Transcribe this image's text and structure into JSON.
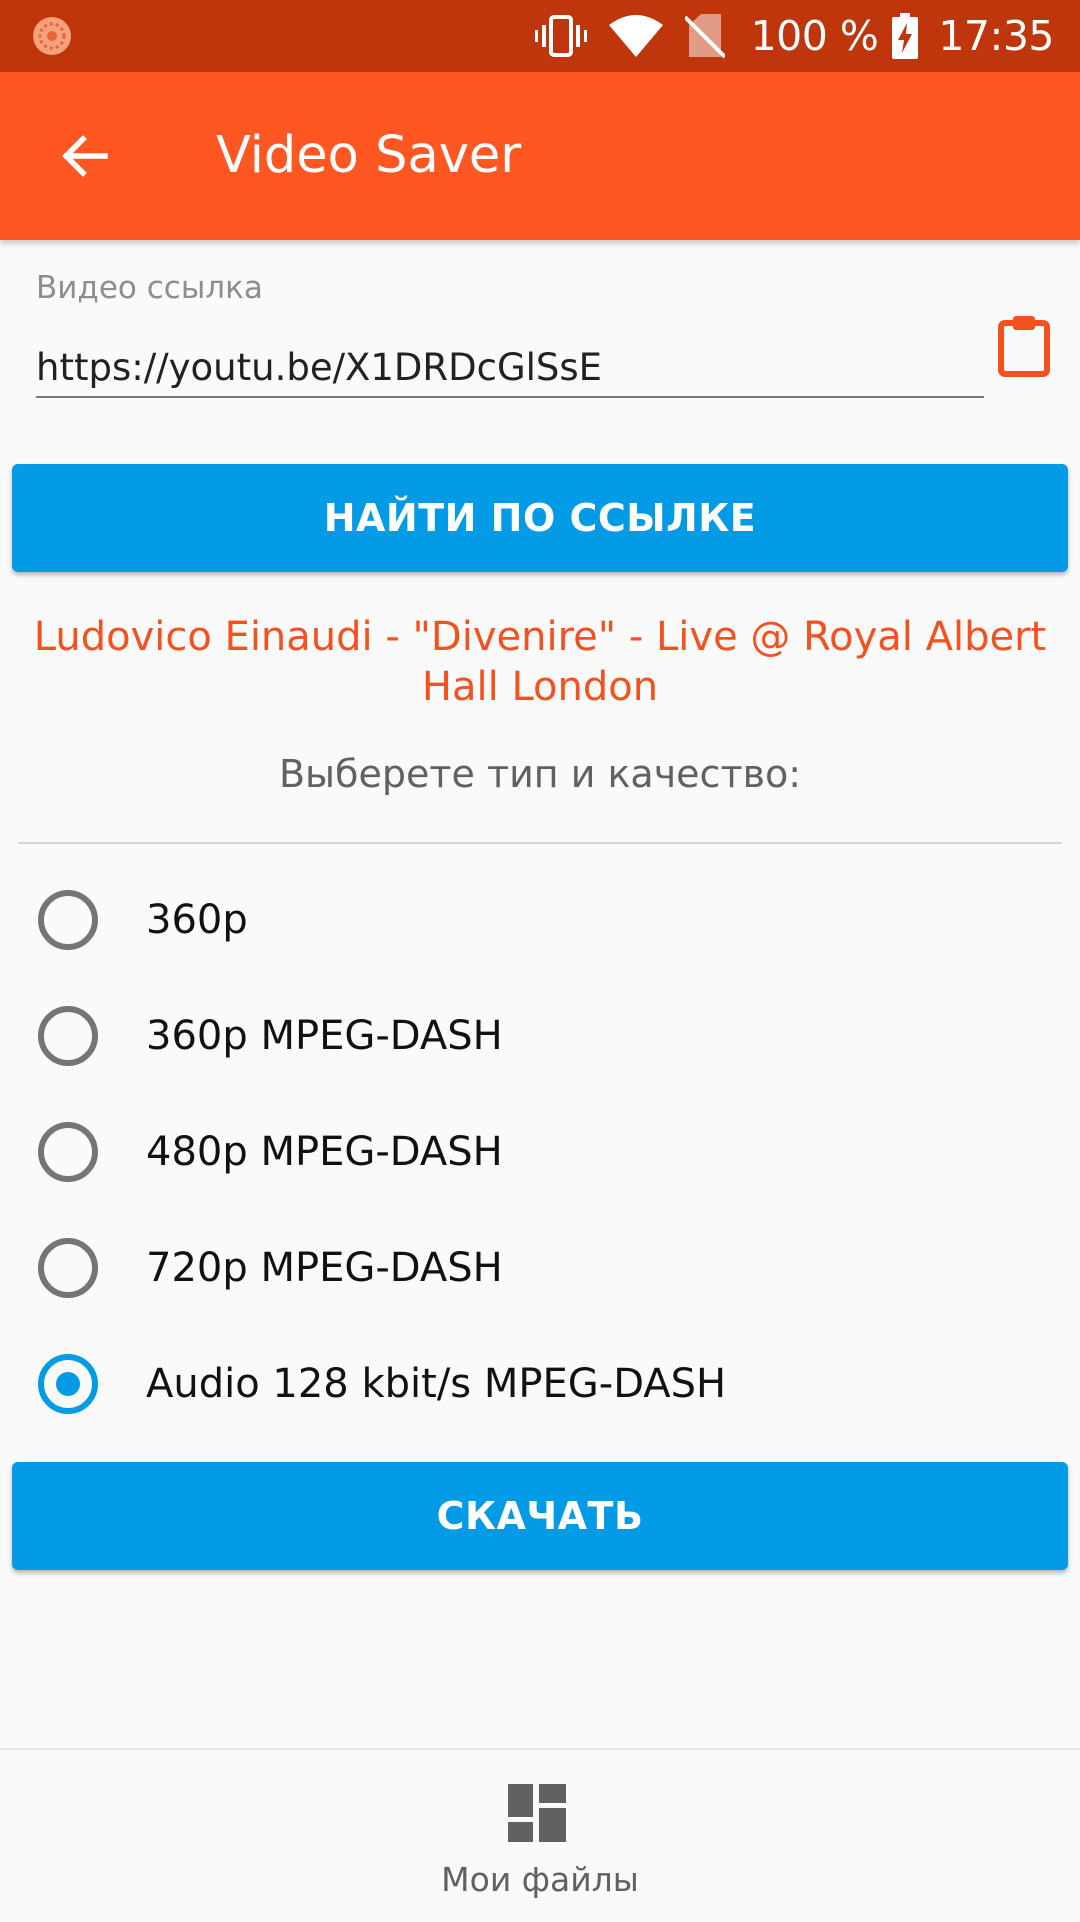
{
  "status_bar": {
    "battery_text": "100 %",
    "time": "17:35",
    "icons": [
      "notification-app-icon",
      "vibrate-icon",
      "wifi-icon",
      "no-sim-icon",
      "battery-charging-icon"
    ]
  },
  "app_bar": {
    "title": "Video Saver",
    "back_icon": "arrow-back-icon"
  },
  "link_field": {
    "label": "Видео ссылка",
    "value": "https://youtu.be/X1DRDcGlSsE",
    "paste_icon": "clipboard-icon"
  },
  "find_button": {
    "label": "НАЙТИ ПО ССЫЛКЕ"
  },
  "video": {
    "title": "Ludovico Einaudi - \"Divenire\" - Live @ Royal Albert Hall London"
  },
  "choose_label": "Выберете тип и качество:",
  "formats": [
    {
      "label": "360p",
      "selected": false
    },
    {
      "label": "360p MPEG-DASH",
      "selected": false
    },
    {
      "label": "480p MPEG-DASH",
      "selected": false
    },
    {
      "label": "720p MPEG-DASH",
      "selected": false
    },
    {
      "label": "Audio 128 kbit/s MPEG-DASH",
      "selected": true
    }
  ],
  "download_button": {
    "label": "СКАЧАТЬ"
  },
  "bottom_nav": {
    "my_files_label": "Мои файлы",
    "my_files_icon": "dashboard-icon"
  },
  "colors": {
    "status_bar": "#BF360C",
    "app_bar": "#FF5722",
    "accent": "#039BE5",
    "title_text": "#F4511E"
  }
}
